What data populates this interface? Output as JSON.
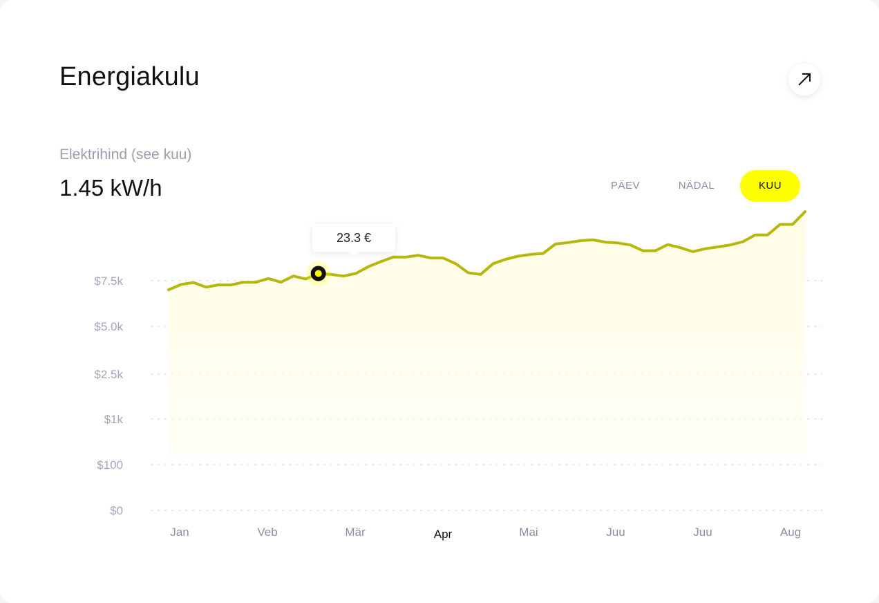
{
  "header": {
    "title": "Energiakulu",
    "expand_icon": "arrow-up-right-icon"
  },
  "summary": {
    "label": "Elektrihind (see kuu)",
    "value": "1.45 kW/h"
  },
  "tabs": [
    {
      "label": "PÄEV",
      "active": false
    },
    {
      "label": "NÄDAL",
      "active": false
    },
    {
      "label": "KUU",
      "active": true
    }
  ],
  "tooltip": {
    "text": "23.3 €"
  },
  "colors": {
    "accent": "#ffff00",
    "line": "#b5b80a",
    "fill": "#fffde5",
    "marker": "#111111"
  },
  "chart_data": {
    "type": "area",
    "y_ticks": [
      "$0",
      "$100",
      "$1k",
      "$2.5k",
      "$5.0k",
      "$7.5k"
    ],
    "x_ticks": [
      "Jan",
      "Veb",
      "Mär",
      "Apr",
      "Mai",
      "Juu",
      "Juu",
      "Aug"
    ],
    "active_x_tick": 3,
    "grid": true,
    "highlight_index": 12,
    "series": [
      {
        "values": [
          7.0,
          7.3,
          7.4,
          7.15,
          7.27,
          7.27,
          7.42,
          7.42,
          7.62,
          7.42,
          7.76,
          7.6,
          7.9,
          7.85,
          7.76,
          7.9,
          8.27,
          8.55,
          8.8,
          8.8,
          8.9,
          8.75,
          8.75,
          8.44,
          7.94,
          7.85,
          8.44,
          8.68,
          8.85,
          8.95,
          9.0,
          9.52,
          9.6,
          9.7,
          9.75,
          9.62,
          9.58,
          9.47,
          9.15,
          9.15,
          9.49,
          9.32,
          9.1,
          9.26,
          9.36,
          9.47,
          9.64,
          10.02,
          10.02,
          10.6,
          10.6,
          11.3
        ]
      }
    ]
  }
}
